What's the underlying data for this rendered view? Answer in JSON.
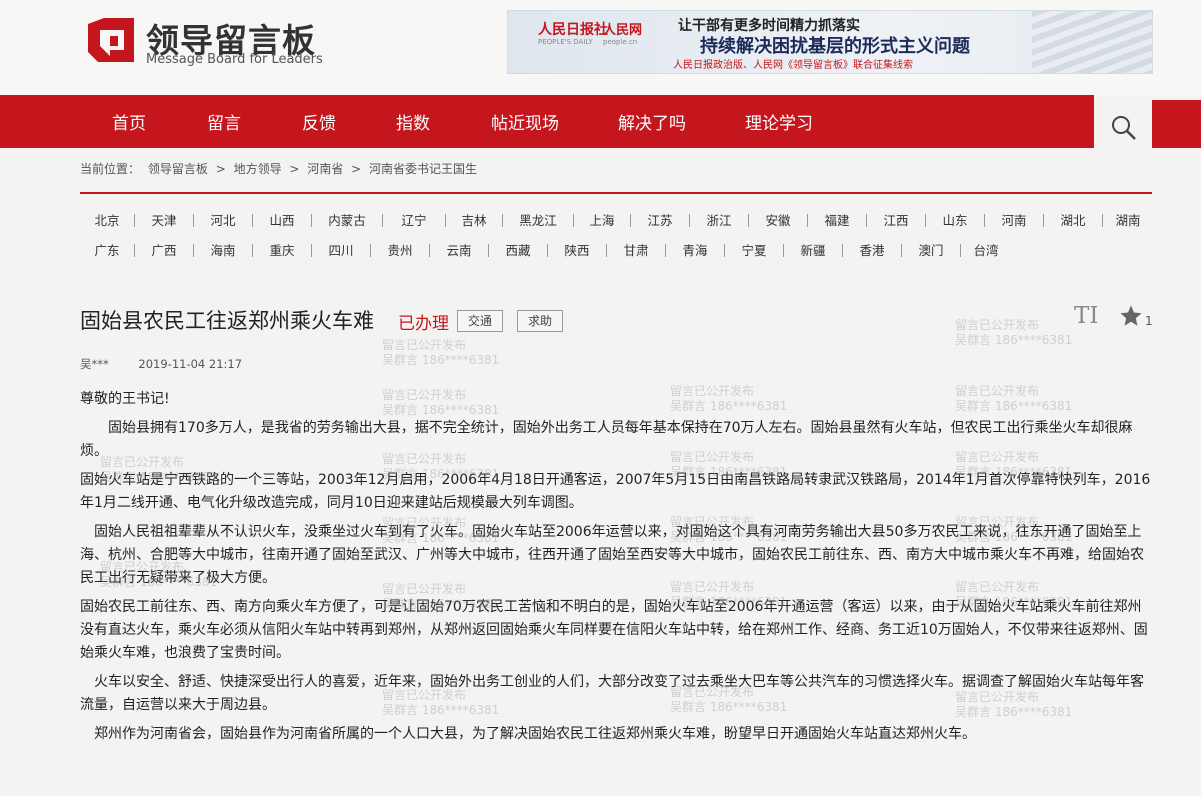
{
  "site": {
    "name_cn": "领导留言板",
    "name_en": "Message Board for Leaders"
  },
  "banner": {
    "brand1": "人民日报社",
    "brand1_sub": "PEOPLE'S DAILY",
    "brand2": "人民网",
    "brand2_sub": "people.cn",
    "line1": "让干部有更多时间精力抓落实",
    "line2": "持续解决困扰基层的形式主义问题",
    "line3": "人民日报政治版、人民网《领导留言板》联合征集线索"
  },
  "nav": [
    "首页",
    "留言",
    "反馈",
    "指数",
    "帖近现场",
    "解决了吗",
    "理论学习"
  ],
  "breadcrumb": {
    "prefix": "当前位置：",
    "items": [
      "领导留言板",
      "地方领导",
      "河南省",
      "河南省委书记王国生"
    ],
    "sep": ">"
  },
  "provinces": {
    "row1": [
      "北京",
      "天津",
      "河北",
      "山西",
      "内蒙古",
      "辽宁",
      "吉林",
      "黑龙江",
      "上海",
      "江苏",
      "浙江",
      "安徽",
      "福建",
      "江西",
      "山东",
      "河南",
      "湖北",
      "湖南"
    ],
    "row2": [
      "广东",
      "广西",
      "海南",
      "重庆",
      "四川",
      "贵州",
      "云南",
      "西藏",
      "陕西",
      "甘肃",
      "青海",
      "宁夏",
      "新疆",
      "香港",
      "澳门",
      "台湾"
    ]
  },
  "post": {
    "title": "固始县农民工往返郑州乘火车难",
    "status": "已办理",
    "tags": [
      "交通",
      "求助"
    ],
    "font_icon": "TI",
    "favorites": "1",
    "author": "吴***",
    "date": "2019-11-04 21:17",
    "greeting": "尊敬的王书记!",
    "paragraphs": [
      "　　固始县拥有170多万人，是我省的劳务输出大县，据不完全统计，固始外出务工人员每年基本保持在70万人左右。固始县虽然有火车站，但农民工出行乘坐火车却很麻烦。",
      " 固始火车站是宁西铁路的一个三等站，2003年12月启用，2006年4月18日开通客运，2007年5月15日由南昌铁路局转隶武汉铁路局，2014年1月首次停靠特快列车，2016年1月二线开通、电气化升级改造完成，同月10日迎来建站后规模最大列车调图。",
      "　固始人民祖祖辈辈从不认识火车，没乘坐过火车到有了火车。固始火车站至2006年运营以来，对固始这个具有河南劳务输出大县50多万农民工来说，往东开通了固始至上海、杭州、合肥等大中城市，往南开通了固始至武汉、广州等大中城市，往西开通了固始至西安等大中城市，固始农民工前往东、西、南方大中城市乘火车不再难，给固始农民工出行无疑带来了极大方便。",
      " 固始农民工前往东、西、南方向乘火车方便了，可是让固始70万农民工苦恼和不明白的是，固始火车站至2006年开通运营（客运）以来，由于从固始火车站乘火车前往郑州没有直达火车，乘火车必须从信阳火车站中转再到郑州，从郑州返回固始乘火车同样要在信阳火车站中转，给在郑州工作、经商、务工近10万固始人，不仅带来往返郑州、固始乘火车难，也浪费了宝贵时间。",
      "　火车以安全、舒适、快捷深受出行人的喜爱，近年来，固始外出务工创业的人们，大部分改变了过去乘坐大巴车等公共汽车的习惯选择火车。据调查了解固始火车站每年客流量，自运营以来大于周边县。",
      "　郑州作为河南省会，固始县作为河南省所属的一个人口大县，为了解决固始农民工往返郑州乘火车难，盼望早日开通固始火车站直达郑州火车。"
    ]
  },
  "watermark": {
    "line1": "留言已公开发布",
    "line2": "吴群言 186****6381"
  },
  "colors": {
    "accent": "#c4161c"
  }
}
